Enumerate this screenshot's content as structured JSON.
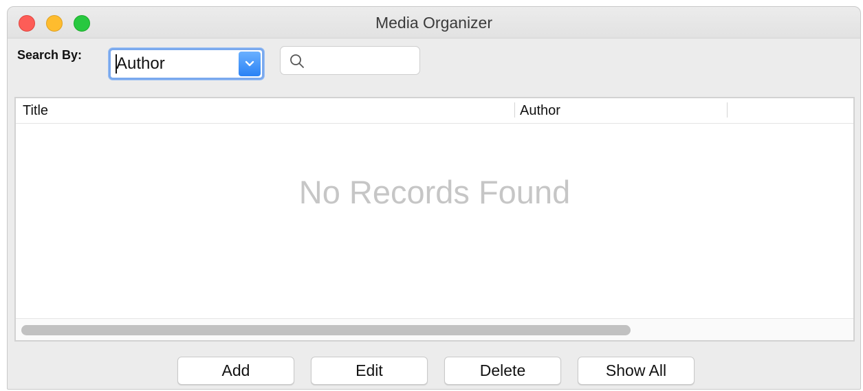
{
  "window": {
    "title": "Media Organizer"
  },
  "search": {
    "label": "Search By:",
    "field_selected": "Author",
    "query_value": "",
    "search_icon": "magnifier-icon"
  },
  "table": {
    "columns": [
      "Title",
      "Author"
    ],
    "rows": [],
    "empty_message": "No Records Found"
  },
  "buttons": {
    "add": "Add",
    "edit": "Edit",
    "delete": "Delete",
    "show_all": "Show All"
  },
  "colors": {
    "close": "#fd5d57",
    "minimize": "#febc2e",
    "maximize": "#28c840",
    "accent": "#2a82f5"
  }
}
